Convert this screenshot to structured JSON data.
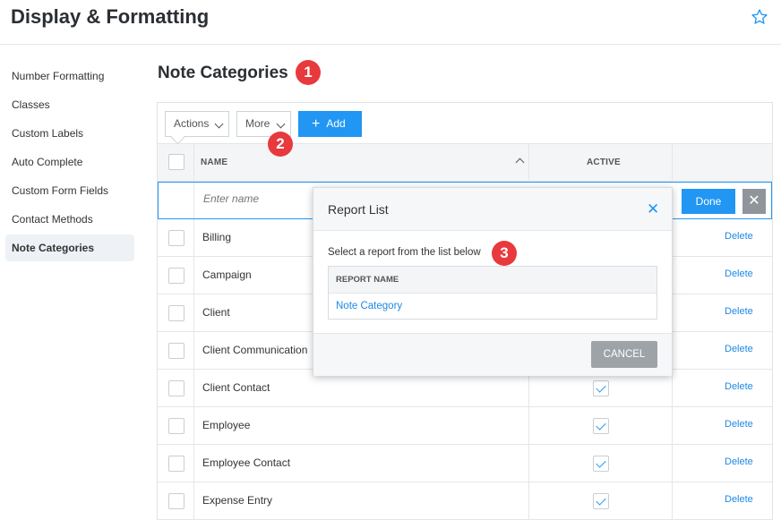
{
  "header": {
    "title": "Display & Formatting",
    "favorite_icon": "star-icon"
  },
  "sidebar": {
    "items": [
      {
        "label": "Number Formatting"
      },
      {
        "label": "Classes"
      },
      {
        "label": "Custom Labels"
      },
      {
        "label": "Auto Complete"
      },
      {
        "label": "Custom Form Fields"
      },
      {
        "label": "Contact Methods"
      },
      {
        "label": "Note Categories",
        "active": true
      }
    ]
  },
  "section": {
    "title": "Note Categories"
  },
  "badges": [
    "1",
    "2",
    "3"
  ],
  "toolbar": {
    "actions_label": "Actions",
    "more_label": "More",
    "add_label": "Add",
    "add_icon": "plus-icon"
  },
  "table": {
    "columns": {
      "name": "NAME",
      "active": "ACTIVE"
    },
    "edit_row": {
      "placeholder": "Enter name",
      "done_label": "Done",
      "close_label": "✕"
    },
    "rows": [
      {
        "name": "Billing",
        "active": true,
        "delete": "Delete"
      },
      {
        "name": "Campaign",
        "active": true,
        "delete": "Delete"
      },
      {
        "name": "Client",
        "active": true,
        "delete": "Delete"
      },
      {
        "name": "Client Communication",
        "active": true,
        "delete": "Delete"
      },
      {
        "name": "Client Contact",
        "active": true,
        "delete": "Delete"
      },
      {
        "name": "Employee",
        "active": true,
        "delete": "Delete"
      },
      {
        "name": "Employee Contact",
        "active": true,
        "delete": "Delete"
      },
      {
        "name": "Expense Entry",
        "active": true,
        "delete": "Delete"
      }
    ]
  },
  "modal": {
    "title": "Report List",
    "close_icon": "close-icon",
    "close_glyph": "✕",
    "instruction": "Select a report from the list below",
    "column_header": "REPORT NAME",
    "reports": [
      "Note Category"
    ],
    "cancel_label": "CANCEL"
  },
  "colors": {
    "accent": "#2196f3",
    "badge": "#e8393d",
    "link": "#1e88e5"
  }
}
